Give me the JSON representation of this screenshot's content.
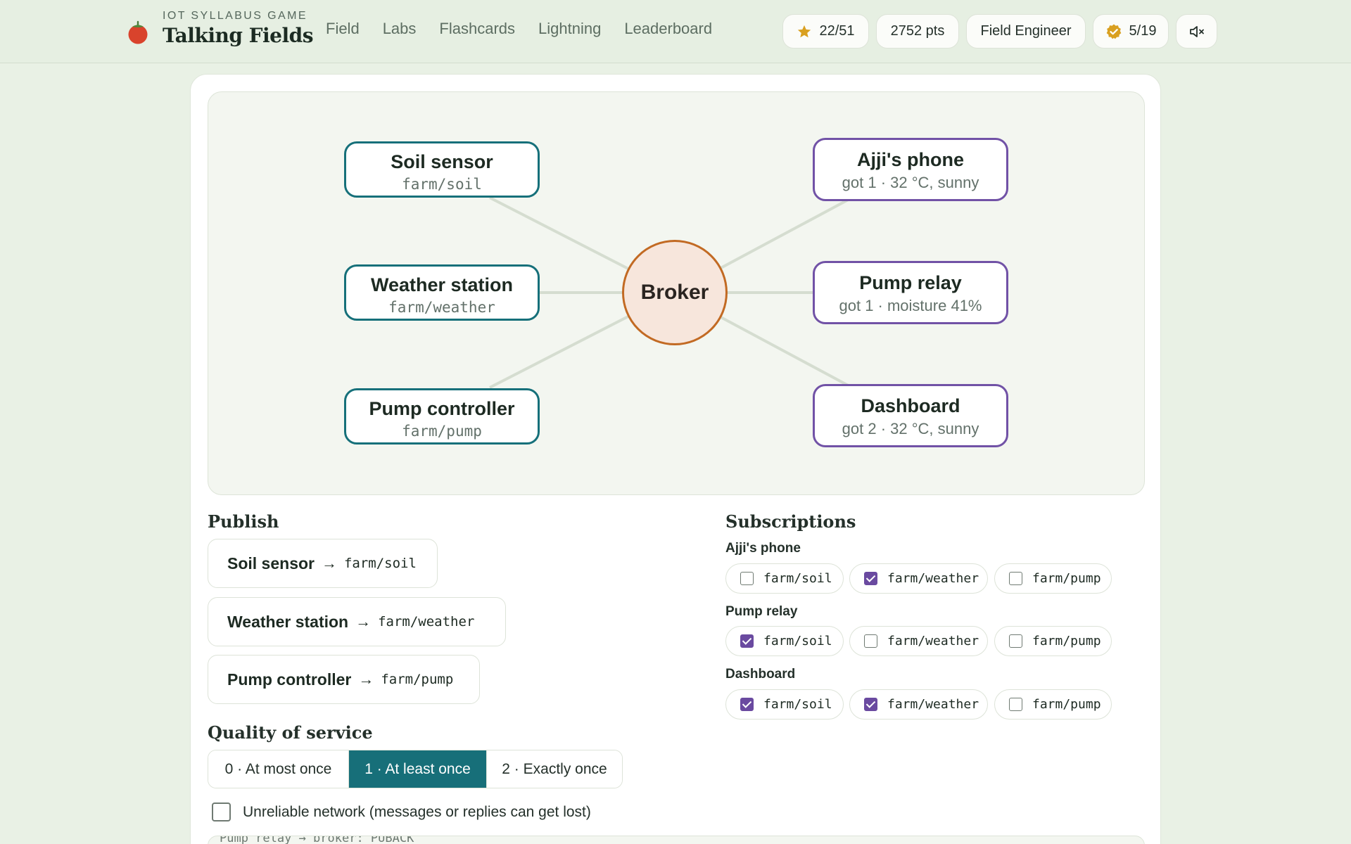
{
  "header": {
    "kicker": "IOT SYLLABUS GAME",
    "title": "Talking Fields",
    "nav": [
      "Field",
      "Labs",
      "Flashcards",
      "Lightning",
      "Leaderboard"
    ],
    "stars": "22/51",
    "points": "2752 pts",
    "rank": "Field Engineer",
    "badges": "5/19",
    "icons": {
      "stars": "star-icon",
      "badges": "badge-check-icon",
      "sound": "speaker-muted-icon",
      "logo": "tomato-icon"
    }
  },
  "diagram": {
    "broker": "Broker",
    "publishers": [
      {
        "name": "Soil sensor",
        "topic": "farm/soil"
      },
      {
        "name": "Weather station",
        "topic": "farm/weather"
      },
      {
        "name": "Pump controller",
        "topic": "farm/pump"
      }
    ],
    "subscribers": [
      {
        "name": "Ajji's phone",
        "status": "got 1 · 32 °C, sunny"
      },
      {
        "name": "Pump relay",
        "status": "got 1 · moisture 41%"
      },
      {
        "name": "Dashboard",
        "status": "got 2 · 32 °C, sunny"
      }
    ]
  },
  "publish": {
    "title": "Publish",
    "buttons": [
      {
        "name": "Soil sensor",
        "arrow": "→",
        "topic": "farm/soil"
      },
      {
        "name": "Weather station",
        "arrow": "→",
        "topic": "farm/weather"
      },
      {
        "name": "Pump controller",
        "arrow": "→",
        "topic": "farm/pump"
      }
    ]
  },
  "qos": {
    "title": "Quality of service",
    "options": [
      "0 · At most once",
      "1 · At least once",
      "2 · Exactly once"
    ],
    "selected": "1 · At least once"
  },
  "network": {
    "label": "Unreliable network (messages or replies can get lost)",
    "checked": false
  },
  "log": {
    "partial_line": "Pump relay → broker: PUBACK"
  },
  "subscriptions": {
    "title": "Subscriptions",
    "groups": [
      {
        "name": "Ajji's phone",
        "topics": [
          {
            "topic": "farm/soil",
            "checked": false
          },
          {
            "topic": "farm/weather",
            "checked": true
          },
          {
            "topic": "farm/pump",
            "checked": false
          }
        ]
      },
      {
        "name": "Pump relay",
        "topics": [
          {
            "topic": "farm/soil",
            "checked": true
          },
          {
            "topic": "farm/weather",
            "checked": false
          },
          {
            "topic": "farm/pump",
            "checked": false
          }
        ]
      },
      {
        "name": "Dashboard",
        "topics": [
          {
            "topic": "farm/soil",
            "checked": true
          },
          {
            "topic": "farm/weather",
            "checked": true
          },
          {
            "topic": "farm/pump",
            "checked": false
          }
        ]
      }
    ]
  },
  "colors": {
    "publisher": "#16707a",
    "subscriber": "#7152a6",
    "broker": "#c26a23",
    "qos_active": "#176f79",
    "checked": "#6a4aa0"
  }
}
